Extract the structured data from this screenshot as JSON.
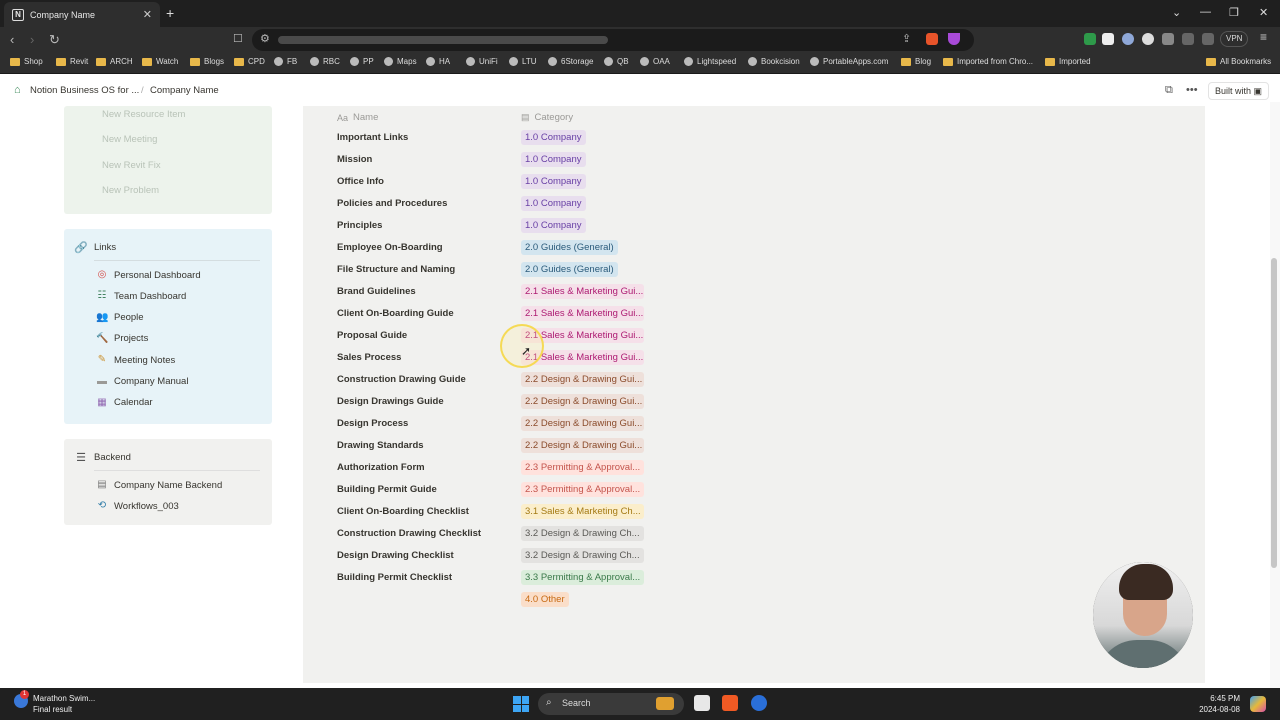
{
  "browser": {
    "tab_title": "Company Name",
    "tab_favicon": "N",
    "vpn_label": "VPN",
    "bookmarks": [
      {
        "label": "Shop",
        "icon": "folder-icon"
      },
      {
        "label": "Revit",
        "icon": "folder-icon"
      },
      {
        "label": "ARCH",
        "icon": "folder-icon"
      },
      {
        "label": "Watch",
        "icon": "folder-icon"
      },
      {
        "label": "Blogs",
        "icon": "folder-icon"
      },
      {
        "label": "CPD",
        "icon": "folder-icon"
      },
      {
        "label": "FB",
        "icon": "facebook-icon"
      },
      {
        "label": "RBC",
        "icon": "bank-icon"
      },
      {
        "label": "PP",
        "icon": "paypal-icon"
      },
      {
        "label": "Maps",
        "icon": "maps-icon"
      },
      {
        "label": "HA",
        "icon": "home-icon"
      },
      {
        "label": "UniFi",
        "icon": "unifi-icon"
      },
      {
        "label": "LTU",
        "icon": "globe-icon"
      },
      {
        "label": "6Storage",
        "icon": "globe-icon"
      },
      {
        "label": "QB",
        "icon": "quickbooks-icon"
      },
      {
        "label": "OAA",
        "icon": "globe-icon"
      },
      {
        "label": "Lightspeed",
        "icon": "flame-icon"
      },
      {
        "label": "Bookcision",
        "icon": "globe-icon"
      },
      {
        "label": "PortableApps.com",
        "icon": "globe-icon"
      },
      {
        "label": "Blog",
        "icon": "folder-icon"
      },
      {
        "label": "Imported from Chro...",
        "icon": "folder-icon"
      },
      {
        "label": "Imported",
        "icon": "folder-icon"
      }
    ],
    "all_bookmarks": "All Bookmarks"
  },
  "notion": {
    "breadcrumb_root": "Notion Business OS for ...",
    "breadcrumb_page": "Company Name",
    "built_with": "Built with"
  },
  "sidebar": {
    "new_items": [
      "New Resource Item",
      "New Meeting",
      "New Revit Fix",
      "New Problem"
    ],
    "links_title": "Links",
    "links": [
      {
        "label": "Personal Dashboard",
        "icon": "target-icon"
      },
      {
        "label": "Team Dashboard",
        "icon": "checklist-icon"
      },
      {
        "label": "People",
        "icon": "people-icon"
      },
      {
        "label": "Projects",
        "icon": "hammer-icon"
      },
      {
        "label": "Meeting Notes",
        "icon": "pencil-icon"
      },
      {
        "label": "Company Manual",
        "icon": "folder-icon"
      },
      {
        "label": "Calendar",
        "icon": "calendar-icon"
      }
    ],
    "backend_title": "Backend",
    "backend_items": [
      {
        "label": "Company Name Backend",
        "icon": "document-icon"
      },
      {
        "label": "Workflows_003",
        "icon": "workflow-icon"
      }
    ]
  },
  "table": {
    "col_name": "Name",
    "col_category": "Category",
    "rows": [
      {
        "name": "Important Links",
        "category": "1.0 Company",
        "color": "purple"
      },
      {
        "name": "Mission",
        "category": "1.0 Company",
        "color": "purple"
      },
      {
        "name": "Office Info",
        "category": "1.0 Company",
        "color": "purple"
      },
      {
        "name": "Policies and Procedures",
        "category": "1.0 Company",
        "color": "purple"
      },
      {
        "name": "Principles",
        "category": "1.0 Company",
        "color": "purple"
      },
      {
        "name": "Employee On-Boarding",
        "category": "2.0 Guides (General)",
        "color": "blue"
      },
      {
        "name": "File Structure and Naming",
        "category": "2.0 Guides (General)",
        "color": "blue"
      },
      {
        "name": "Brand Guidelines",
        "category": "2.1 Sales & Marketing Gui...",
        "color": "pink"
      },
      {
        "name": "Client On-Boarding Guide",
        "category": "2.1 Sales & Marketing Gui...",
        "color": "pink"
      },
      {
        "name": "Proposal Guide",
        "category": "2.1 Sales & Marketing Gui...",
        "color": "pink"
      },
      {
        "name": "Sales Process",
        "category": "2.1 Sales & Marketing Gui...",
        "color": "pink"
      },
      {
        "name": "Construction Drawing Guide",
        "category": "2.2 Design & Drawing Gui...",
        "color": "brown"
      },
      {
        "name": "Design Drawings Guide",
        "category": "2.2 Design & Drawing Gui...",
        "color": "brown"
      },
      {
        "name": "Design Process",
        "category": "2.2 Design & Drawing Gui...",
        "color": "brown"
      },
      {
        "name": "Drawing Standards",
        "category": "2.2 Design & Drawing Gui...",
        "color": "brown"
      },
      {
        "name": "Authorization Form",
        "category": "2.3 Permitting & Approval...",
        "color": "red"
      },
      {
        "name": "Building Permit Guide",
        "category": "2.3 Permitting & Approval...",
        "color": "red"
      },
      {
        "name": "Client On-Boarding Checklist",
        "category": "3.1 Sales & Marketing Ch...",
        "color": "yellow"
      },
      {
        "name": "Construction Drawing Checklist",
        "category": "3.2 Design & Drawing Ch...",
        "color": "gray"
      },
      {
        "name": "Design Drawing Checklist",
        "category": "3.2 Design & Drawing Ch...",
        "color": "gray"
      },
      {
        "name": "Building Permit Checklist",
        "category": "3.3 Permitting & Approval...",
        "color": "green"
      },
      {
        "name": "",
        "category": "4.0 Other",
        "color": "orange"
      }
    ]
  },
  "taskbar": {
    "weather_title": "Marathon Swim...",
    "weather_sub": "Final result",
    "weather_badge": "1",
    "search_label": "Search",
    "time": "6:45 PM",
    "date": "2024-08-08"
  }
}
